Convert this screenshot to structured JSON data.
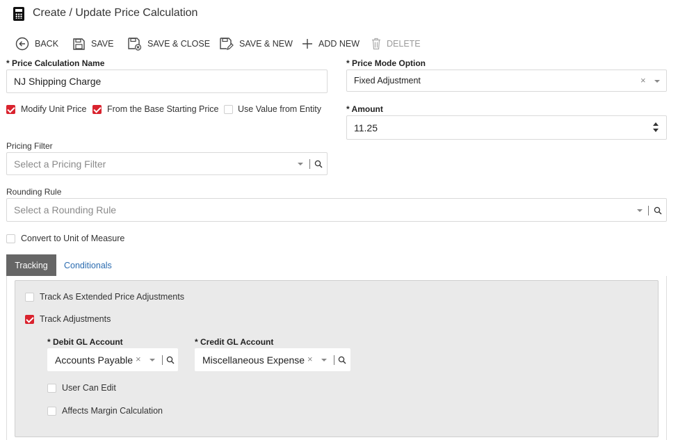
{
  "window": {
    "title": "Create / Update Price Calculation",
    "title_icon": "calculator-icon"
  },
  "toolbar": {
    "back_label": "BACK",
    "save_label": "SAVE",
    "save_close_label": "SAVE & CLOSE",
    "save_new_label": "SAVE & NEW",
    "add_new_label": "ADD NEW",
    "delete_label": "DELETE"
  },
  "form": {
    "name": {
      "label": "* Price Calculation Name",
      "value": "NJ Shipping Charge"
    },
    "price_mode": {
      "label": "* Price Mode Option",
      "value": "Fixed Adjustment"
    },
    "modify_unit_price": {
      "label": "Modify Unit Price",
      "checked": true
    },
    "from_base_price": {
      "label": "From the Base Starting Price",
      "checked": true
    },
    "use_value_entity": {
      "label": "Use Value from Entity",
      "checked": false
    },
    "amount": {
      "label": "* Amount",
      "value": "11.25"
    },
    "pricing_filter": {
      "label": "Pricing Filter",
      "placeholder": "Select a Pricing Filter"
    },
    "rounding_rule": {
      "label": "Rounding Rule",
      "placeholder": "Select a Rounding Rule"
    },
    "convert_uom": {
      "label": "Convert to Unit of Measure",
      "checked": false
    }
  },
  "tabs": [
    {
      "label": "Tracking",
      "active": true
    },
    {
      "label": "Conditionals",
      "active": false
    }
  ],
  "tracking": {
    "track_extended": {
      "label": "Track As Extended Price Adjustments",
      "checked": false
    },
    "track_adjustments": {
      "label": "Track Adjustments",
      "checked": true
    },
    "debit_gl": {
      "label": "* Debit GL Account",
      "value": "Accounts Payable"
    },
    "credit_gl": {
      "label": "* Credit GL Account",
      "value": "Miscellaneous Expense"
    },
    "user_can_edit": {
      "label": "User Can Edit",
      "checked": false
    },
    "affects_margin": {
      "label": "Affects Margin Calculation",
      "checked": false
    }
  },
  "colors": {
    "accent_red": "#d9232e",
    "tab_active_bg": "#666666",
    "link_blue": "#2b6cb0",
    "panel_bg": "#eaeaea"
  }
}
